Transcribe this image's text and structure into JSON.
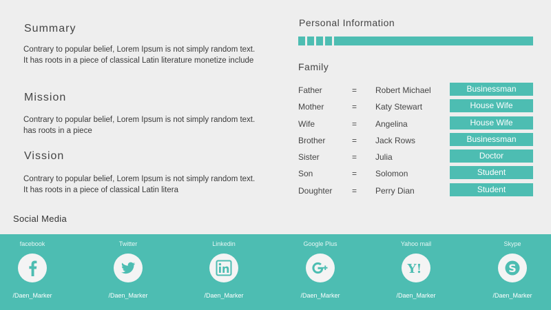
{
  "summary": {
    "title": "Summary",
    "text": "Contrary to popular belief, Lorem Ipsum is not simply random text. It has roots in a piece of classical Latin literature monetize include"
  },
  "mission": {
    "title": "Mission",
    "text": "Contrary to popular belief, Lorem Ipsum is not simply random text. has roots in a piece"
  },
  "vission": {
    "title": "Vission",
    "text": "Contrary to popular belief, Lorem Ipsum is not simply random text. It has roots in a piece of classical Latin litera"
  },
  "personal_information": {
    "title": "Personal Information"
  },
  "family": {
    "title": "Family",
    "separator": "=",
    "members": [
      {
        "relation": "Father",
        "name": "Robert Michael",
        "occupation": "Businessman"
      },
      {
        "relation": "Mother",
        "name": "Katy Stewart",
        "occupation": "House Wife"
      },
      {
        "relation": "Wife",
        "name": "Angelina",
        "occupation": "House Wife"
      },
      {
        "relation": "Brother",
        "name": "Jack Rows",
        "occupation": "Businessman"
      },
      {
        "relation": "Sister",
        "name": "Julia",
        "occupation": "Doctor"
      },
      {
        "relation": "Son",
        "name": "Solomon",
        "occupation": "Student"
      },
      {
        "relation": "Doughter",
        "name": "Perry Dian",
        "occupation": "Student"
      }
    ]
  },
  "social_media": {
    "title": "Social Media",
    "items": [
      {
        "label": "facebook",
        "handle": "/Daen_Marker",
        "icon": "facebook-icon"
      },
      {
        "label": "Twitter",
        "handle": "/Daen_Marker",
        "icon": "twitter-icon"
      },
      {
        "label": "Linkedin",
        "handle": "/Daen_Marker",
        "icon": "linkedin-icon"
      },
      {
        "label": "Google Plus",
        "handle": "/Daen_Marker",
        "icon": "google-plus-icon"
      },
      {
        "label": "Yahoo mail",
        "handle": "/Daen_Marker",
        "icon": "yahoo-icon"
      },
      {
        "label": "Skype",
        "handle": "/Daen_Marker",
        "icon": "skype-icon"
      }
    ]
  },
  "colors": {
    "accent": "#4dbdb2",
    "background": "#eeeeee",
    "icon_circle": "#f4f4f4"
  }
}
